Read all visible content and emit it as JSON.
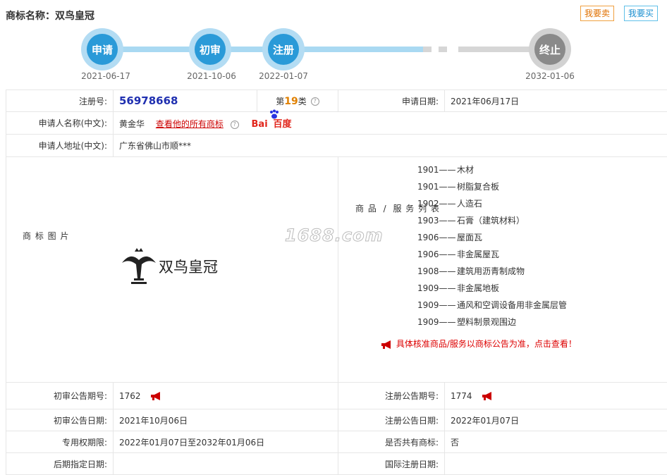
{
  "header": {
    "title": "商标名称：双鸟皇冠",
    "sell_label": "我要卖",
    "buy_label": "我要买"
  },
  "progress": {
    "steps": [
      {
        "label": "申请",
        "date": "2021-06-17",
        "status": "done"
      },
      {
        "label": "初审",
        "date": "2021-10-06",
        "status": "done"
      },
      {
        "label": "注册",
        "date": "2022-01-07",
        "status": "done"
      },
      {
        "label": "终止",
        "date": "2032-01-06",
        "status": "pending"
      }
    ]
  },
  "info": {
    "reg_no_label": "注册号:",
    "reg_no": "56978668",
    "class_prefix": "第",
    "class_num": "19",
    "class_suffix": "类",
    "apply_date_label": "申请日期:",
    "apply_date": "2021年06月17日",
    "applicant_label": "申请人名称(中文):",
    "applicant": "黄金华",
    "applicant_link": "查看他的所有商标",
    "baidu_bai": "Bai",
    "baidu_du": "百度",
    "address_label": "申请人地址(中文):",
    "address": "广东省佛山市顺***",
    "image_label": [
      "商",
      "标",
      "图",
      "片"
    ],
    "logo_text": "双鸟皇冠",
    "goods_label": [
      "商",
      "品",
      "/",
      "服",
      "务",
      "列",
      "表"
    ],
    "goods": [
      {
        "code": "1901",
        "name": "木材"
      },
      {
        "code": "1901",
        "name": "树脂复合板"
      },
      {
        "code": "1902",
        "name": "人造石"
      },
      {
        "code": "1903",
        "name": "石膏（建筑材料）"
      },
      {
        "code": "1906",
        "name": "屋面瓦"
      },
      {
        "code": "1906",
        "name": "非金属屋瓦"
      },
      {
        "code": "1908",
        "name": "建筑用沥青制成物"
      },
      {
        "code": "1909",
        "name": "非金属地板"
      },
      {
        "code": "1909",
        "name": "通风和空调设备用非金属层管"
      },
      {
        "code": "1909",
        "name": "塑料制景观围边"
      }
    ],
    "goods_dash": "——",
    "goods_notice": "具体核准商品/服务以商标公告为准，点击查看！",
    "prelim_no_label": "初审公告期号:",
    "prelim_no": "1762",
    "reg_pub_no_label": "注册公告期号:",
    "reg_pub_no": "1774",
    "prelim_date_label": "初审公告日期:",
    "prelim_date": "2021年10月06日",
    "reg_pub_date_label": "注册公告日期:",
    "reg_pub_date": "2022年01月07日",
    "period_label": "专用权期限:",
    "period": "2022年01月07日至2032年01月06日",
    "shared_label": "是否共有商标:",
    "shared": "否",
    "later_label": "后期指定日期:",
    "later": "",
    "intl_label": "国际注册日期:",
    "intl": ""
  },
  "watermark": "1688.com",
  "colors": {
    "blue": "#2a9ad8",
    "track": "#a9d9f2",
    "gray": "#8a8a8a",
    "red": "#c00000",
    "navy": "#1f2fb0"
  }
}
